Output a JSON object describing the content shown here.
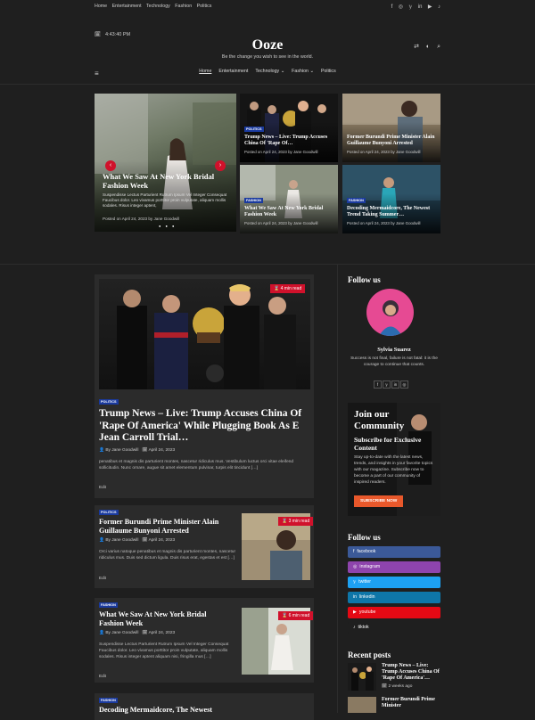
{
  "topbar": {
    "links": [
      "Home",
      "Entertainment",
      "Technology",
      "Fashion",
      "Politics"
    ]
  },
  "header": {
    "time": "4:43:40 PM",
    "logo": "Ooze",
    "tagline": "Be the change you wish to see in the world."
  },
  "nav": {
    "items": [
      "Home",
      "Entertainment",
      "Technology",
      "Fashion",
      "Politics"
    ]
  },
  "hero": {
    "main": {
      "title": "What We Saw At New York Bridal Fashion Week",
      "excerpt": "Suspendisse Lectus Parturient Rutrum Ipsum Vel Integer Consequat Faucibus dolor. Leo vivamus porttitor proin vulputate, aliquam mollis sodales. Risus integer aptent,",
      "meta": "Posted on April 24, 2023 by Jane Goodwill"
    },
    "cards": [
      {
        "badge": "POLITICS",
        "title": "Trump News – Live: Trump Accuses China Of 'Rape Of…",
        "meta": "Posted on April 24, 2023 by Jane Goodwill"
      },
      {
        "badge": "",
        "title": "Former Burundi Prime Minister Alain Guillaume Bunyoni Arrested",
        "meta": "Posted on April 24, 2023 by Jane Goodwill"
      },
      {
        "badge": "FASHION",
        "title": "What We Saw At New York Bridal Fashion Week",
        "meta": "Posted on April 24, 2023 by Jane Goodwill"
      },
      {
        "badge": "FASHION",
        "title": "Decoding Mermaidcore, The Newest Trend Taking Summer…",
        "meta": "Posted on April 24, 2023 by Jane Goodwill"
      }
    ]
  },
  "posts": [
    {
      "badge": "POLITICS",
      "read": "4 min read",
      "title": "Trump News – Live: Trump Accuses China Of 'Rape Of America' While Plugging Book As E Jean Carroll Trial…",
      "author": "By Jane Goodwill",
      "date": "April 24, 2023",
      "excerpt": "penatibus et magnis dis parturient montes, nascetur ridiculus mus. Vestibulum luctus orci vitae eleifend sollicitudin. Nunc ornare, augue sit amet elementum pulvinar, turpis elit tincidunt […]",
      "edit": "Edit"
    },
    {
      "badge": "POLITICS",
      "read": "3 min read",
      "title": "Former Burundi Prime Minister Alain Guillaume Bunyoni Arrested",
      "author": "By Jane Goodwill",
      "date": "April 24, 2023",
      "excerpt": "Orci varius natoque penatibus et magnis dis parturient montes, nascetur ridiculus mus. Duis sed dictum ligula. Duis risus erat, egestas et est […]",
      "edit": "Edit"
    },
    {
      "badge": "FASHION",
      "read": "6 min read",
      "title": "What We Saw At New York Bridal Fashion Week",
      "author": "By Jane Goodwill",
      "date": "April 24, 2023",
      "excerpt": "Suspendisse Lectus Parturient Rutrum Ipsum Vel Integer Consequat Faucibus dolor. Leo vivamus porttitor proin vulputate, aliquam mollis sodales. Risus integer aptent aliquam nisi, fringilla mus […]",
      "edit": "Edit"
    },
    {
      "badge": "FASHION",
      "title": "Decoding Mermaidcore, The Newest"
    }
  ],
  "sidebar": {
    "follow_title": "Follow us",
    "author_name": "Sylvia Suarez",
    "author_bio": "Success is not final, failure is not fatal: it is the courage to continue that counts.",
    "community": {
      "title": "Join our Community",
      "subtitle": "Subscribe for Exclusive Content",
      "text": "Stay up-to-date with the latest news, trends, and insights in your favorite topics with our magazine. Subscribe now to become a part of our community of inspired readers.",
      "button": "SUBSCRIBE NOW"
    },
    "follow2_title": "Follow us",
    "buttons": [
      {
        "label": "facebook",
        "color": "#3b5998"
      },
      {
        "label": "instagram",
        "color": "#8e44ad"
      },
      {
        "label": "twitter",
        "color": "#1da1f2"
      },
      {
        "label": "linkedin",
        "color": "#0e76a8"
      },
      {
        "label": "youtube",
        "color": "#e50914"
      },
      {
        "label": "tiktok",
        "color": "#1f1f1f"
      }
    ],
    "recent_title": "Recent posts",
    "recent": [
      {
        "title": "Trump News – Live: Trump Accuses China Of 'Rape Of America'…",
        "time": "2 weeks ago"
      },
      {
        "title": "Former Burundi Prime Minister"
      }
    ]
  }
}
